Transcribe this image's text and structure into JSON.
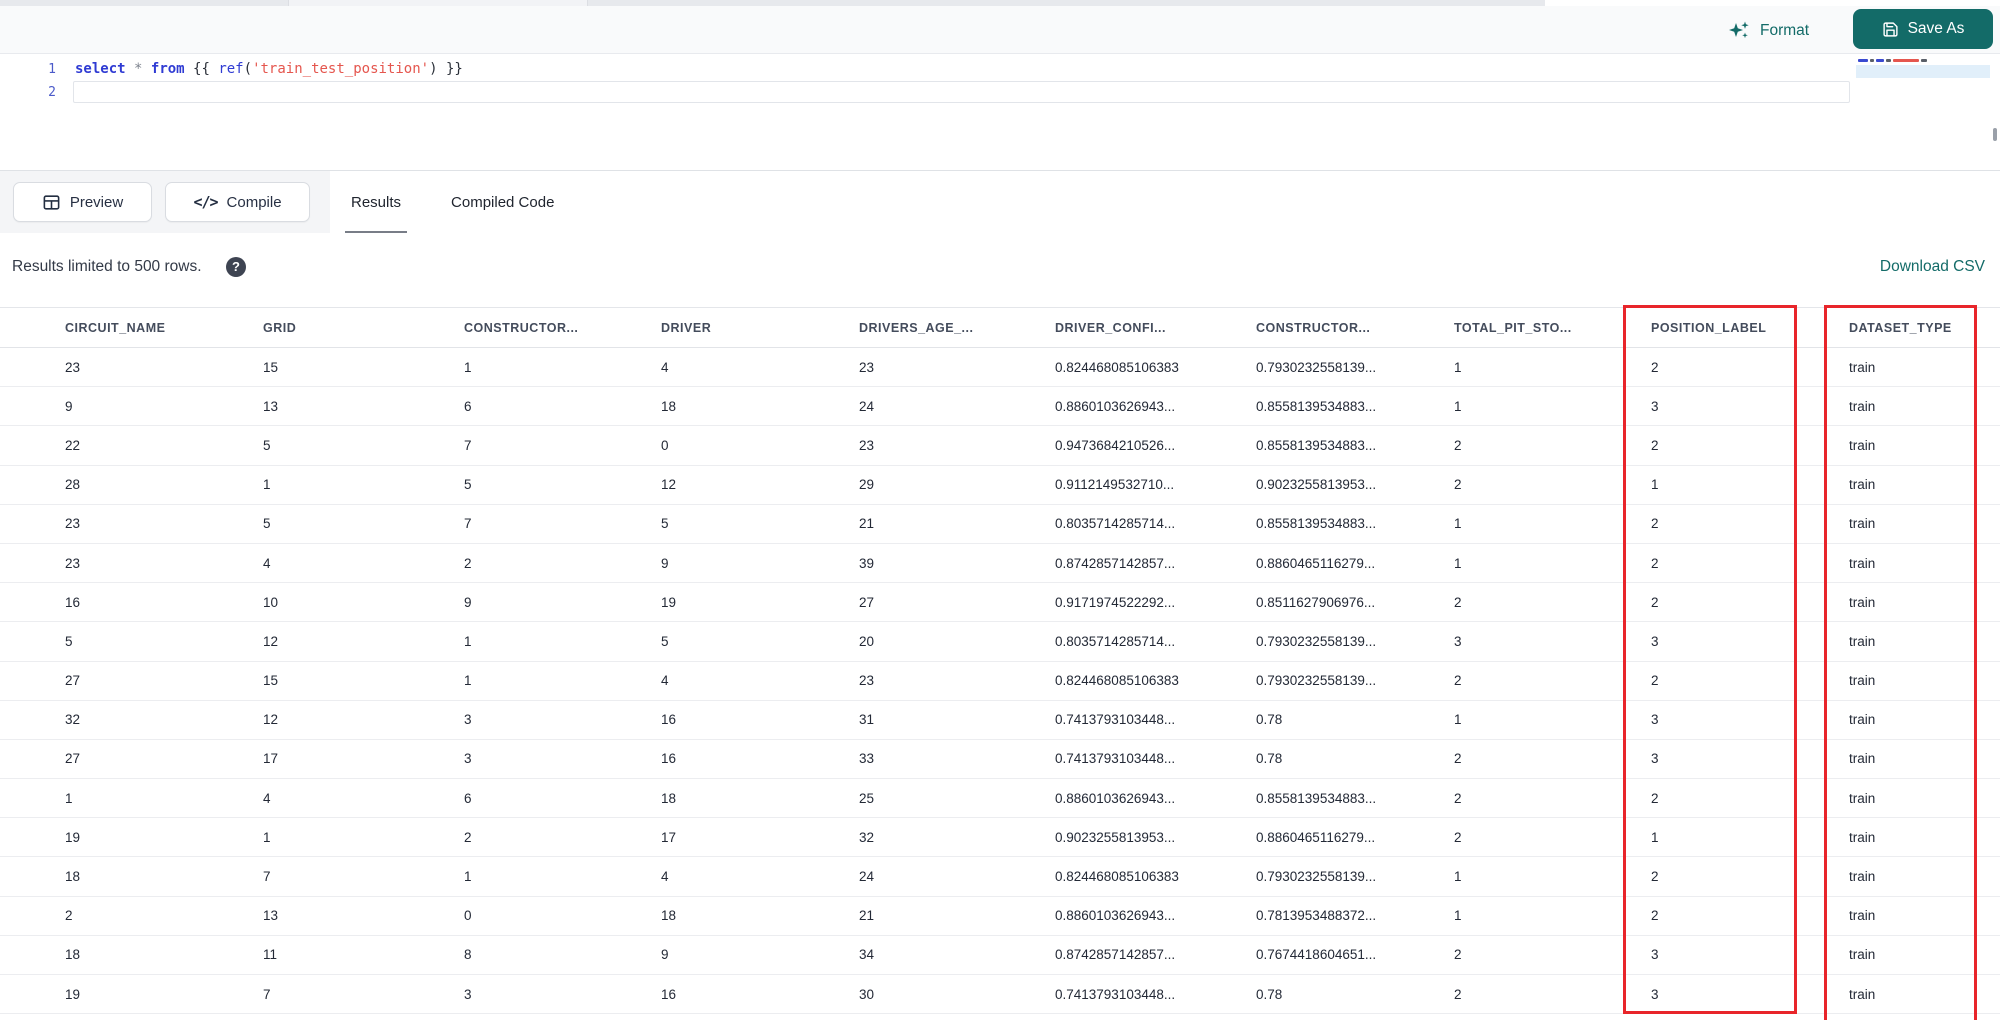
{
  "toolbar": {
    "format_label": "Format",
    "save_as_label": "Save As"
  },
  "code": {
    "line_numbers": [
      "1",
      "2"
    ],
    "lines": [
      {
        "tokens": [
          {
            "t": "select",
            "c": "kw"
          },
          {
            "t": " ",
            "c": "pl"
          },
          {
            "t": "*",
            "c": "op"
          },
          {
            "t": " ",
            "c": "pl"
          },
          {
            "t": "from",
            "c": "kw"
          },
          {
            "t": " {{ ",
            "c": "pl"
          },
          {
            "t": "ref",
            "c": "fn"
          },
          {
            "t": "(",
            "c": "pl"
          },
          {
            "t": "'train_test_position'",
            "c": "str"
          },
          {
            "t": ")",
            "c": "pl"
          },
          {
            "t": " }}",
            "c": "pl"
          }
        ]
      }
    ]
  },
  "panel": {
    "preview_label": "Preview",
    "compile_label": "Compile",
    "compile_glyph": "</>",
    "tabs": [
      {
        "label": "Results",
        "active": true
      },
      {
        "label": "Compiled Code",
        "active": false
      }
    ]
  },
  "results_bar": {
    "limit_text": "Results limited to 500 rows.",
    "help_glyph": "?",
    "download_label": "Download CSV"
  },
  "table": {
    "columns": [
      "CIRCUIT_NAME",
      "GRID",
      "CONSTRUCTOR...",
      "DRIVER",
      "DRIVERS_AGE_...",
      "DRIVER_CONFI...",
      "CONSTRUCTOR...",
      "TOTAL_PIT_STO...",
      "POSITION_LABEL",
      "DATASET_TYPE"
    ],
    "rows": [
      [
        "23",
        "15",
        "1",
        "4",
        "23",
        "0.824468085106383",
        "0.7930232558139...",
        "1",
        "2",
        "train"
      ],
      [
        "9",
        "13",
        "6",
        "18",
        "24",
        "0.8860103626943...",
        "0.8558139534883...",
        "1",
        "3",
        "train"
      ],
      [
        "22",
        "5",
        "7",
        "0",
        "23",
        "0.9473684210526...",
        "0.8558139534883...",
        "2",
        "2",
        "train"
      ],
      [
        "28",
        "1",
        "5",
        "12",
        "29",
        "0.9112149532710...",
        "0.9023255813953...",
        "2",
        "1",
        "train"
      ],
      [
        "23",
        "5",
        "7",
        "5",
        "21",
        "0.8035714285714...",
        "0.8558139534883...",
        "1",
        "2",
        "train"
      ],
      [
        "23",
        "4",
        "2",
        "9",
        "39",
        "0.8742857142857...",
        "0.8860465116279...",
        "1",
        "2",
        "train"
      ],
      [
        "16",
        "10",
        "9",
        "19",
        "27",
        "0.9171974522292...",
        "0.8511627906976...",
        "2",
        "2",
        "train"
      ],
      [
        "5",
        "12",
        "1",
        "5",
        "20",
        "0.8035714285714...",
        "0.7930232558139...",
        "3",
        "3",
        "train"
      ],
      [
        "27",
        "15",
        "1",
        "4",
        "23",
        "0.824468085106383",
        "0.7930232558139...",
        "2",
        "2",
        "train"
      ],
      [
        "32",
        "12",
        "3",
        "16",
        "31",
        "0.7413793103448...",
        "0.78",
        "1",
        "3",
        "train"
      ],
      [
        "27",
        "17",
        "3",
        "16",
        "33",
        "0.7413793103448...",
        "0.78",
        "2",
        "3",
        "train"
      ],
      [
        "1",
        "4",
        "6",
        "18",
        "25",
        "0.8860103626943...",
        "0.8558139534883...",
        "2",
        "2",
        "train"
      ],
      [
        "19",
        "1",
        "2",
        "17",
        "32",
        "0.9023255813953...",
        "0.8860465116279...",
        "2",
        "1",
        "train"
      ],
      [
        "18",
        "7",
        "1",
        "4",
        "24",
        "0.824468085106383",
        "0.7930232558139...",
        "1",
        "2",
        "train"
      ],
      [
        "2",
        "13",
        "0",
        "18",
        "21",
        "0.8860103626943...",
        "0.7813953488372...",
        "1",
        "2",
        "train"
      ],
      [
        "18",
        "11",
        "8",
        "9",
        "34",
        "0.8742857142857...",
        "0.7674418604651...",
        "2",
        "3",
        "train"
      ],
      [
        "19",
        "7",
        "3",
        "16",
        "30",
        "0.7413793103448...",
        "0.78",
        "2",
        "3",
        "train"
      ]
    ],
    "highlighted_columns": [
      "POSITION_LABEL",
      "DATASET_TYPE"
    ]
  },
  "icons": {
    "format": "sparkles-icon",
    "save_as": "floppy-disk-icon",
    "preview": "table-grid-icon",
    "compile": "code-icon",
    "help": "question-mark-icon"
  },
  "colors": {
    "accent_teal": "#136b68",
    "highlight_red": "#e8252a",
    "keyword_blue": "#2f3bd3",
    "string_red": "#e5564e"
  }
}
